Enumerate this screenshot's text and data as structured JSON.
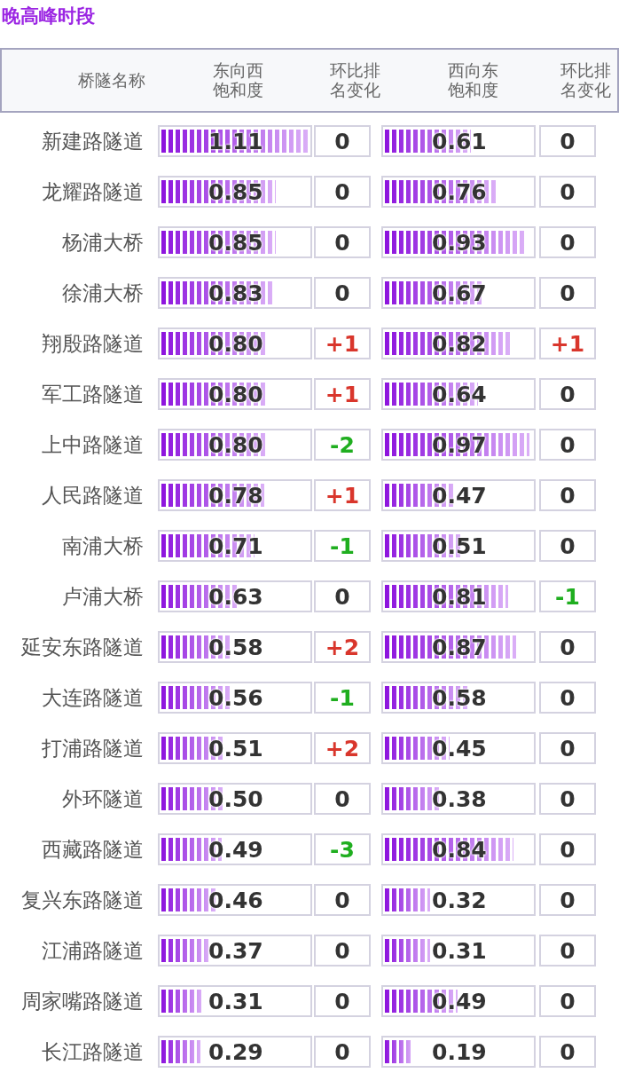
{
  "title": "晚高峰时段",
  "columns": [
    "桥隧名称",
    "东向西饱和度",
    "环比排名变化",
    "西向东饱和度",
    "环比排名变化"
  ],
  "rows": [
    {
      "name": "新建路隧道",
      "east": {
        "reading": "1.11",
        "level": 0.98
      },
      "east_rank": {
        "text": "0",
        "kind": "same"
      },
      "west": {
        "reading": "0.61",
        "level": 0.57
      },
      "west_rank": {
        "text": "0",
        "kind": "same"
      }
    },
    {
      "name": "龙耀路隧道",
      "east": {
        "reading": "0.85",
        "level": 0.76
      },
      "east_rank": {
        "text": "0",
        "kind": "same"
      },
      "west": {
        "reading": "0.76",
        "level": 0.74
      },
      "west_rank": {
        "text": "0",
        "kind": "same"
      }
    },
    {
      "name": "杨浦大桥",
      "east": {
        "reading": "0.85",
        "level": 0.76
      },
      "east_rank": {
        "text": "0",
        "kind": "same"
      },
      "west": {
        "reading": "0.93",
        "level": 0.93
      },
      "west_rank": {
        "text": "0",
        "kind": "same"
      }
    },
    {
      "name": "徐浦大桥",
      "east": {
        "reading": "0.83",
        "level": 0.74
      },
      "east_rank": {
        "text": "0",
        "kind": "same"
      },
      "west": {
        "reading": "0.67",
        "level": 0.66
      },
      "west_rank": {
        "text": "0",
        "kind": "same"
      }
    },
    {
      "name": "翔殷路隧道",
      "east": {
        "reading": "0.80",
        "level": 0.7
      },
      "east_rank": {
        "text": "+1",
        "kind": "up"
      },
      "west": {
        "reading": "0.82",
        "level": 0.83
      },
      "west_rank": {
        "text": "+1",
        "kind": "up"
      }
    },
    {
      "name": "军工路隧道",
      "east": {
        "reading": "0.80",
        "level": 0.7
      },
      "east_rank": {
        "text": "+1",
        "kind": "up"
      },
      "west": {
        "reading": "0.64",
        "level": 0.62
      },
      "west_rank": {
        "text": "0",
        "kind": "same"
      }
    },
    {
      "name": "上中路隧道",
      "east": {
        "reading": "0.80",
        "level": 0.7
      },
      "east_rank": {
        "text": "-2",
        "kind": "down"
      },
      "west": {
        "reading": "0.97",
        "level": 0.96
      },
      "west_rank": {
        "text": "0",
        "kind": "same"
      }
    },
    {
      "name": "人民路隧道",
      "east": {
        "reading": "0.78",
        "level": 0.68
      },
      "east_rank": {
        "text": "+1",
        "kind": "up"
      },
      "west": {
        "reading": "0.47",
        "level": 0.46
      },
      "west_rank": {
        "text": "0",
        "kind": "same"
      }
    },
    {
      "name": "南浦大桥",
      "east": {
        "reading": "0.71",
        "level": 0.62
      },
      "east_rank": {
        "text": "-1",
        "kind": "down"
      },
      "west": {
        "reading": "0.51",
        "level": 0.5
      },
      "west_rank": {
        "text": "0",
        "kind": "same"
      }
    },
    {
      "name": "卢浦大桥",
      "east": {
        "reading": "0.63",
        "level": 0.52
      },
      "east_rank": {
        "text": "0",
        "kind": "same"
      },
      "west": {
        "reading": "0.81",
        "level": 0.82
      },
      "west_rank": {
        "text": "-1",
        "kind": "down"
      }
    },
    {
      "name": "延安东路隧道",
      "east": {
        "reading": "0.58",
        "level": 0.47
      },
      "east_rank": {
        "text": "+2",
        "kind": "up"
      },
      "west": {
        "reading": "0.87",
        "level": 0.87
      },
      "west_rank": {
        "text": "0",
        "kind": "same"
      }
    },
    {
      "name": "大连路隧道",
      "east": {
        "reading": "0.56",
        "level": 0.46
      },
      "east_rank": {
        "text": "-1",
        "kind": "down"
      },
      "west": {
        "reading": "0.58",
        "level": 0.55
      },
      "west_rank": {
        "text": "0",
        "kind": "same"
      }
    },
    {
      "name": "打浦路隧道",
      "east": {
        "reading": "0.51",
        "level": 0.42
      },
      "east_rank": {
        "text": "+2",
        "kind": "up"
      },
      "west": {
        "reading": "0.45",
        "level": 0.43
      },
      "west_rank": {
        "text": "0",
        "kind": "same"
      }
    },
    {
      "name": "外环隧道",
      "east": {
        "reading": "0.50",
        "level": 0.41
      },
      "east_rank": {
        "text": "0",
        "kind": "same"
      },
      "west": {
        "reading": "0.38",
        "level": 0.36
      },
      "west_rank": {
        "text": "0",
        "kind": "same"
      }
    },
    {
      "name": "西藏路隧道",
      "east": {
        "reading": "0.49",
        "level": 0.4
      },
      "east_rank": {
        "text": "-3",
        "kind": "down"
      },
      "west": {
        "reading": "0.84",
        "level": 0.85
      },
      "west_rank": {
        "text": "0",
        "kind": "same"
      }
    },
    {
      "name": "复兴东路隧道",
      "east": {
        "reading": "0.46",
        "level": 0.36
      },
      "east_rank": {
        "text": "0",
        "kind": "same"
      },
      "west": {
        "reading": "0.32",
        "level": 0.3
      },
      "west_rank": {
        "text": "0",
        "kind": "same"
      }
    },
    {
      "name": "江浦路隧道",
      "east": {
        "reading": "0.37",
        "level": 0.32
      },
      "east_rank": {
        "text": "0",
        "kind": "same"
      },
      "west": {
        "reading": "0.31",
        "level": 0.3
      },
      "west_rank": {
        "text": "0",
        "kind": "same"
      }
    },
    {
      "name": "周家嘴路隧道",
      "east": {
        "reading": "0.31",
        "level": 0.27
      },
      "east_rank": {
        "text": "0",
        "kind": "same"
      },
      "west": {
        "reading": "0.49",
        "level": 0.48
      },
      "west_rank": {
        "text": "0",
        "kind": "same"
      }
    },
    {
      "name": "长江路隧道",
      "east": {
        "reading": "0.29",
        "level": 0.26
      },
      "east_rank": {
        "text": "0",
        "kind": "same"
      },
      "west": {
        "reading": "0.19",
        "level": 0.18
      },
      "west_rank": {
        "text": "0",
        "kind": "same"
      }
    }
  ]
}
